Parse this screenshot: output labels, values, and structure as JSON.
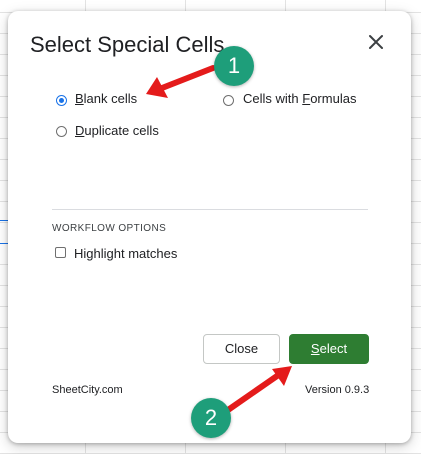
{
  "dialog": {
    "title": "Select Special Cells",
    "close_icon": "close-icon"
  },
  "options": [
    {
      "prefix": "",
      "key": "B",
      "rest": "lank cells",
      "selected": true
    },
    {
      "prefix": "Cells with ",
      "key": "F",
      "rest": "ormulas",
      "selected": false
    },
    {
      "prefix": "",
      "key": "D",
      "rest": "uplicate cells",
      "selected": false
    }
  ],
  "workflow": {
    "section_title": "WORKFLOW OPTIONS",
    "highlight_label": "Highlight matches",
    "highlight_checked": false
  },
  "buttons": {
    "close_label": "Close",
    "select_key": "S",
    "select_rest": "elect"
  },
  "footer": {
    "brand": "SheetCity.com",
    "version": "Version 0.9.3"
  },
  "annotations": {
    "step1": "1",
    "step2": "2"
  },
  "colors": {
    "accent": "#1a73e8",
    "primary_button": "#2e7d32",
    "annotation_arrow": "#e41b1b",
    "annotation_badge": "#1e9e7a"
  }
}
